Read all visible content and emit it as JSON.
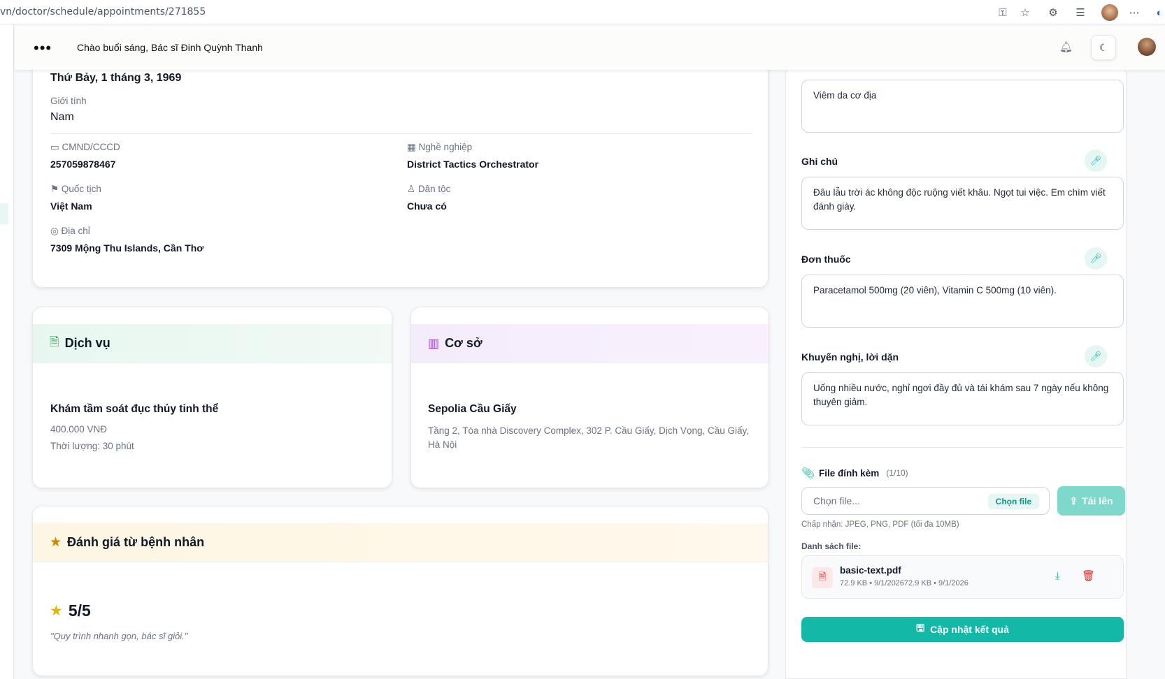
{
  "browser": {
    "url": "vn/doctor/schedule/appointments/271855"
  },
  "topbar": {
    "greeting": "Chào buổi sáng, Bác sĩ Đinh Quỳnh Thanh"
  },
  "patient": {
    "dob": "Thứ Bảy, 1 tháng 3, 1969",
    "gender_label": "Giới tính",
    "gender": "Nam",
    "id_label": "CMND/CCCD",
    "id": "257059878467",
    "job_label": "Nghề nghiệp",
    "job": "District Tactics Orchestrator",
    "nationality_label": "Quốc tịch",
    "nationality": "Việt Nam",
    "ethnicity_label": "Dân tộc",
    "ethnicity": "Chưa có",
    "address_label": "Địa chỉ",
    "address": "7309 Mộng Thu Islands, Cần Thơ"
  },
  "service": {
    "header": "Dịch vụ",
    "name": "Khám tầm soát đục thủy tinh thể",
    "price": "400.000 VNĐ",
    "duration": "Thời lượng: 30 phút"
  },
  "facility": {
    "header": "Cơ sở",
    "name": "Sepolia Cầu Giấy",
    "address": "Tầng 2, Tòa nhà Discovery Complex, 302 P. Cầu Giấy, Dịch Vọng, Cầu Giấy, Hà Nội"
  },
  "review": {
    "header": "Đánh giá từ bệnh nhân",
    "score": "5/5",
    "comment": "\"Quy trình nhanh gọn, bác sĩ giỏi.\""
  },
  "form": {
    "diagnosis": "Viêm da cơ địa",
    "notes_label": "Ghi chú",
    "notes": "Đâu lẫu trời ác không độc ruộng viết khâu. Ngọt tui việc. Em chìm viết đánh giày.",
    "prescription_label": "Đơn thuốc",
    "prescription": "Paracetamol 500mg (20 viên), Vitamin C 500mg (10 viên).",
    "advice_label": "Khuyến nghị, lời dặn",
    "advice": "Uống nhiều nước, nghỉ ngơi đầy đủ và tái khám sau 7 ngày nếu không thuyên giảm.",
    "attach_label": "File đính kèm",
    "attach_count": "(1/10)",
    "file_placeholder": "Chọn file...",
    "choose_file": "Chọn file",
    "upload": "Tải lên",
    "accept_note": "Chấp nhận: JPEG, PNG, PDF (tối đa 10MB)",
    "file_list_label": "Danh sách file:",
    "file_name": "basic-text.pdf",
    "file_meta": "72.9 KB • 9/1/202672.9 KB • 9/1/2026",
    "submit": "Cập nhật kết quả"
  }
}
